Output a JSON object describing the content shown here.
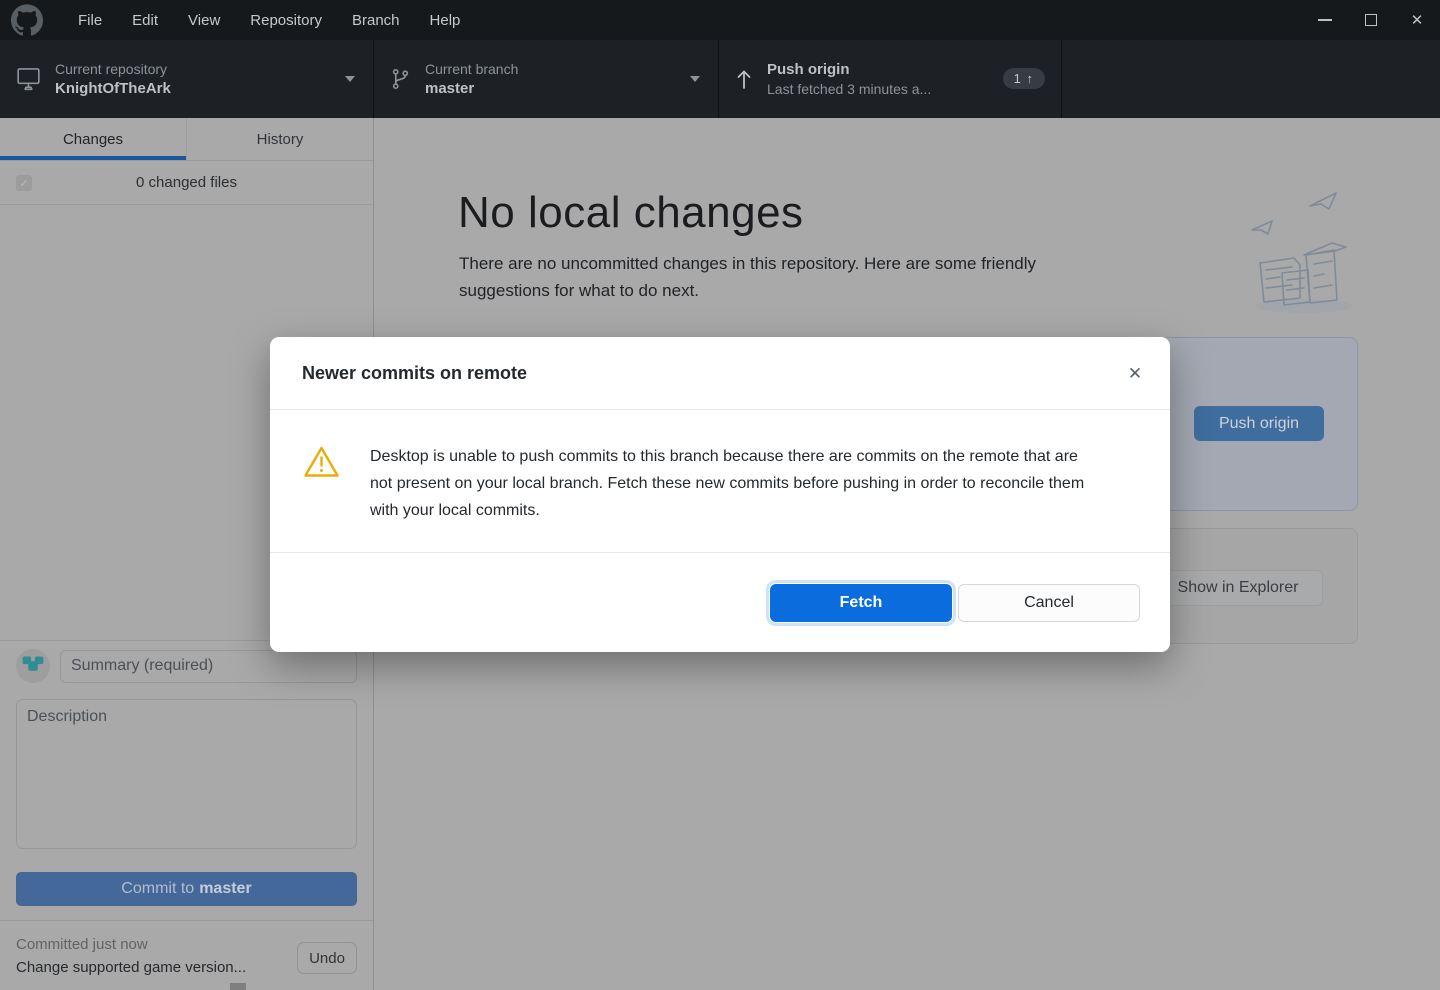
{
  "titlebar": {
    "menu_items": [
      "File",
      "Edit",
      "View",
      "Repository",
      "Branch",
      "Help"
    ],
    "window_controls": {
      "minimize": "–",
      "maximize": "□",
      "close": "✕"
    }
  },
  "toolbar": {
    "repository": {
      "label": "Current repository",
      "value": "KnightOfTheArk"
    },
    "branch": {
      "label": "Current branch",
      "value": "master"
    },
    "push": {
      "title": "Push origin",
      "subtitle": "Last fetched 3 minutes a...",
      "badge": "1 ↑"
    }
  },
  "sidebar": {
    "tabs": [
      "Changes",
      "History"
    ],
    "changed_files": "0 changed files",
    "summary_placeholder": "Summary (required)",
    "description_placeholder": "Description",
    "commit_button": {
      "prefix": "Commit to",
      "branch": "master"
    },
    "history_bar": {
      "status": "Committed just now",
      "message": "Change supported game version...",
      "undo": "Undo"
    }
  },
  "main": {
    "heading": "No local changes",
    "description": "There are no uncommitted changes in this repository. Here are some friendly suggestions for what to do next.",
    "push_card_button": "Push origin",
    "explorer_card_button": "Show in Explorer"
  },
  "dialog": {
    "title": "Newer commits on remote",
    "close": "✕",
    "body": "Desktop is unable to push commits to this branch because there are commits on the remote that are not present on your local branch. Fetch these new commits before pushing in order to reconcile them with your local commits.",
    "primary": "Fetch",
    "secondary": "Cancel"
  },
  "icons": {
    "checkbox_check": "✓"
  },
  "colors": {
    "accent_blue": "#0a6cdd",
    "warning_yellow": "#e7ae06",
    "tab_underline": "#1a55a0",
    "titlebar_bg": "#16191c",
    "toolbar_bg": "#1d2126",
    "dimmed_bg": "#a9a9a9"
  }
}
